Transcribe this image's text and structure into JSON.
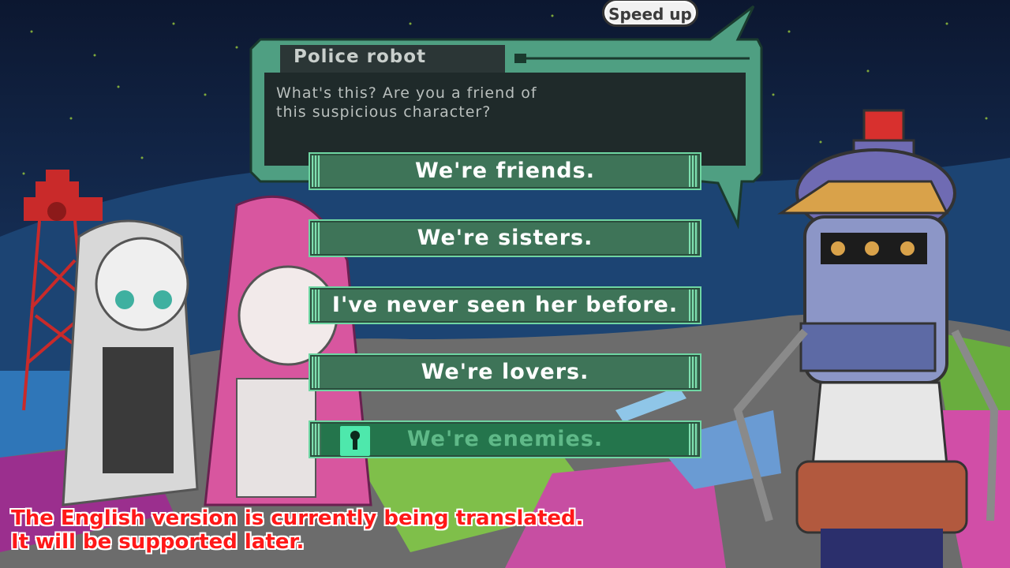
{
  "controls": {
    "speed_up_label": "Speed up"
  },
  "dialog": {
    "speaker": "Police robot",
    "text": "What's this? Are you a friend of\nthis suspicious character?"
  },
  "choices": [
    {
      "label": "We're friends.",
      "locked": false
    },
    {
      "label": "We're sisters.",
      "locked": false
    },
    {
      "label": "I've never seen her before.",
      "locked": false
    },
    {
      "label": "We're lovers.",
      "locked": false
    },
    {
      "label": "We're enemies.",
      "locked": true
    }
  ],
  "notice": {
    "line1": "The English version is currently being translated.",
    "line2": "It will be supported later."
  },
  "icons": {
    "lock": "keyhole-lock-icon",
    "speech_tail": "speech-tail"
  },
  "colors": {
    "choice_bg": "#3e7458",
    "choice_border": "#6fd6a3",
    "locked_bg": "#24754c",
    "dialog_bg": "#1f2a2a",
    "dialog_frame": "#4f9f82",
    "notice_text": "#ff1818"
  }
}
